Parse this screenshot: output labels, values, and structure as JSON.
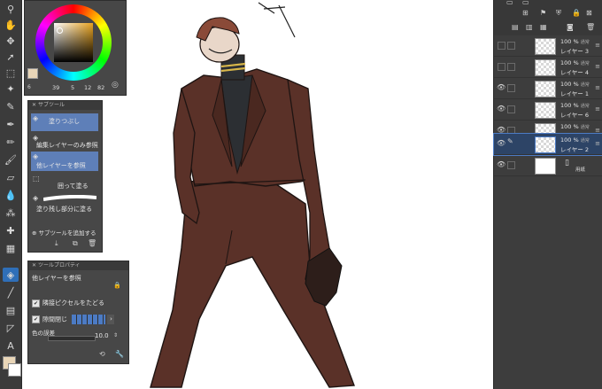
{
  "color_panel": {
    "values": [
      "39",
      "5",
      "12",
      "82"
    ],
    "ruler_value": "6"
  },
  "sub_tool": {
    "title": "サブツール",
    "items": [
      {
        "label": "塗りつぶし",
        "selected": true
      },
      {
        "label": "編集レイヤーのみ参照",
        "selected": false
      },
      {
        "label": "他レイヤーを参照",
        "selected": true
      },
      {
        "label": "囲って塗る",
        "selected": false
      },
      {
        "label": "塗り残し部分に塗る",
        "selected": false
      }
    ],
    "add_label": "サブツールを追加する"
  },
  "tool_property": {
    "title": "ツールプロパティ",
    "name": "他レイヤーを参照",
    "close_gap_label": "隣接ピクセルをたどる",
    "gap_label": "隙間閉じ",
    "tolerance_label": "色の誤差",
    "tolerance_value": "10.0"
  },
  "layers": [
    {
      "opacity": "100 %",
      "blend": "通常",
      "name": "レイヤー 3",
      "visible": false,
      "selected": false
    },
    {
      "opacity": "100 %",
      "blend": "通常",
      "name": "レイヤー 4",
      "visible": false,
      "selected": false
    },
    {
      "opacity": "100 %",
      "blend": "通常",
      "name": "レイヤー 1",
      "visible": true,
      "selected": false
    },
    {
      "opacity": "100 %",
      "blend": "通常",
      "name": "レイヤー 6",
      "visible": true,
      "selected": false
    },
    {
      "opacity": "100 %",
      "blend": "通常",
      "name": "レイヤー 5",
      "visible": true,
      "selected": false
    },
    {
      "opacity": "100 %",
      "blend": "通常",
      "name": "レイヤー 2",
      "visible": true,
      "selected": true
    },
    {
      "opacity": "",
      "blend": "",
      "name": "用紙",
      "visible": true,
      "selected": false
    }
  ],
  "colors": {
    "suit": "#5a3128",
    "shirt": "#2c2f33",
    "hair": "#8a4a38",
    "accent": "#2f6fb8",
    "gold": "#d7b64a"
  }
}
